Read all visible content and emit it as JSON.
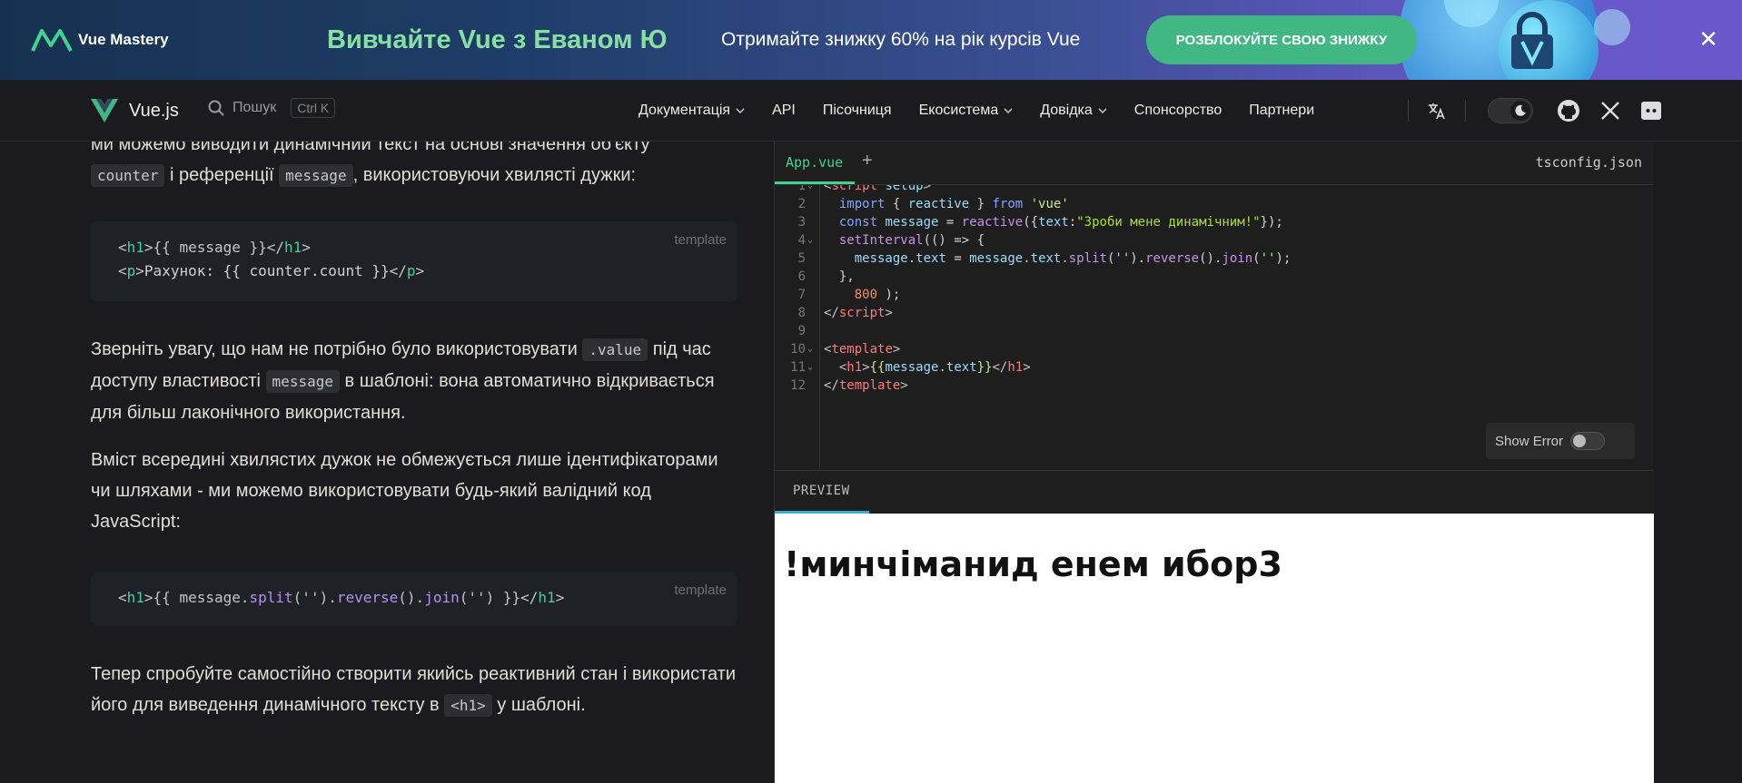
{
  "banner": {
    "brand": "Vue Mastery",
    "title": "Вивчайте Vue з Еваном Ю",
    "subtitle": "Отримайте знижку 60% на рік курсів Vue",
    "cta": "РОЗБЛОКУЙТЕ СВОЮ ЗНИЖКУ",
    "close_icon": "close-icon"
  },
  "nav": {
    "brand": "Vue.js",
    "search_label": "Пошук",
    "search_kbd": "Ctrl K",
    "items": [
      {
        "label": "Документація",
        "dropdown": true
      },
      {
        "label": "API",
        "dropdown": false
      },
      {
        "label": "Пісочниця",
        "dropdown": false
      },
      {
        "label": "Екосистема",
        "dropdown": true
      },
      {
        "label": "Довідка",
        "dropdown": true
      },
      {
        "label": "Спонсорство",
        "dropdown": false
      },
      {
        "label": "Партнери",
        "dropdown": false
      }
    ],
    "icons": [
      "translate-icon",
      "theme-toggle",
      "github-icon",
      "x-icon",
      "discord-icon"
    ]
  },
  "doc": {
    "p1_a": "ми можемо виводити динамічний текст на основі значення об'єкту",
    "p1_code1": "counter",
    "p1_b": "і референції",
    "p1_code2": "message",
    "p1_c": ", використовуючи хвилясті дужки:",
    "code1_lang": "template",
    "code1_line2_text": "Рахунок: {{ counter.count }}",
    "p2_a": "Зверніть увагу, що нам не потрібно було використовувати",
    "p2_code1": ".value",
    "p2_b": "під час доступу властивості",
    "p2_code2": "message",
    "p2_c": "в шаблоні: вона автоматично відкривається для більш лаконічного використання.",
    "p3": "Вміст всередині хвилястих дужок не обмежується лише ідентифікаторами чи шляхами - ми можемо використовувати будь-який валідний код JavaScript:",
    "code2_lang": "template",
    "p4_a": "Тепер спробуйте самостійно створити якийсь реактивний стан і використати його для виведення динамічного тексту в",
    "p4_code": "<h1>",
    "p4_b": "у шаблоні."
  },
  "playground": {
    "tab_active": "App.vue",
    "tab_add": "+",
    "tab_right": "tsconfig.json",
    "show_error": "Show Error",
    "preview_label": "PREVIEW",
    "preview_output": "!минчіманид енем ибор3",
    "message_text": "Зроби мене динамічним!",
    "interval_ms": "800"
  }
}
